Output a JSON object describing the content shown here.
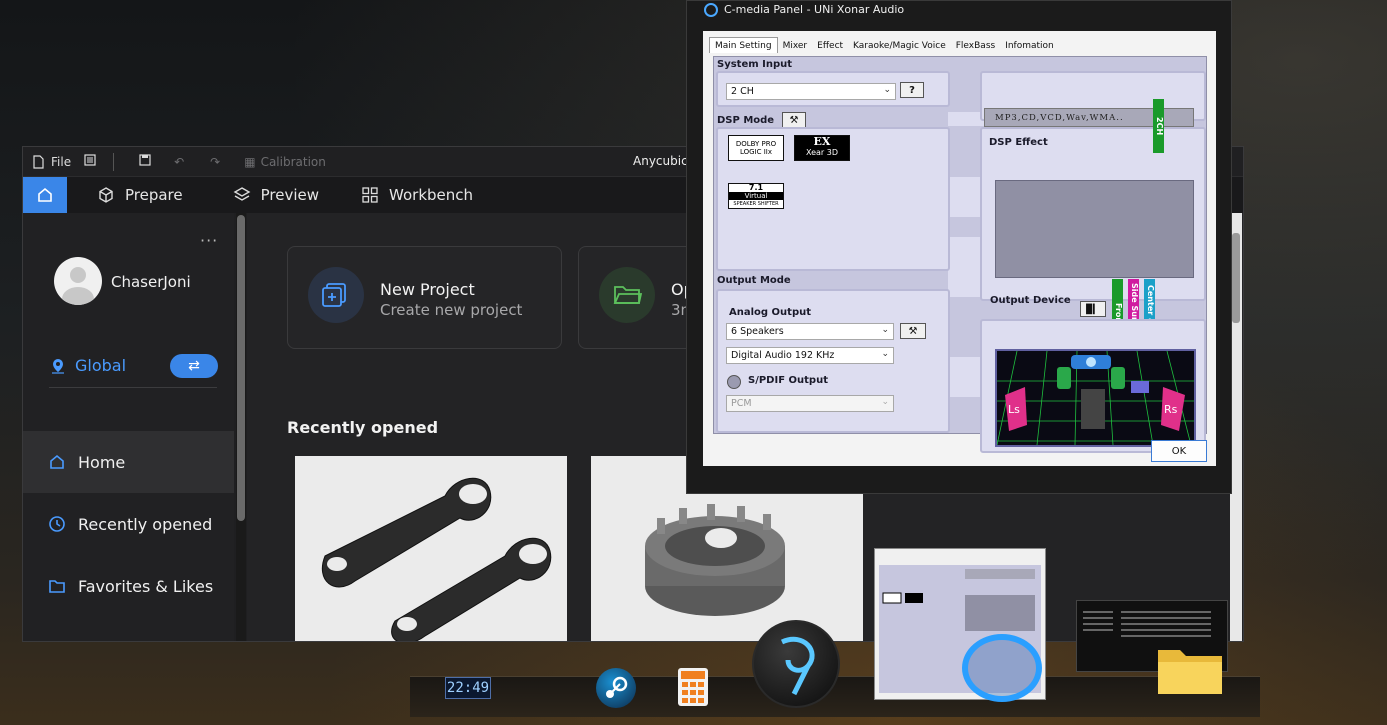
{
  "anycubic": {
    "title": "Anycubic S",
    "toolbar": {
      "file_label": "File",
      "calibration_label": "Calibration"
    },
    "nav": {
      "prepare": "Prepare",
      "preview": "Preview",
      "workbench": "Workbench"
    },
    "user": {
      "name": "ChaserJoni",
      "more": "···"
    },
    "region": {
      "label": "Global",
      "swap_symbol": "⇄"
    },
    "sidebar": [
      {
        "label": "Home",
        "icon": "home-icon"
      },
      {
        "label": "Recently opened",
        "icon": "clock-icon"
      },
      {
        "label": "Favorites & Likes",
        "icon": "folder-icon"
      }
    ],
    "cards": {
      "new_title": "New Project",
      "new_sub": "Create new project",
      "open_title": "Op",
      "open_sub": "3m"
    },
    "recent_heading": "Recently opened",
    "accent": "#3a86e8"
  },
  "cmedia": {
    "title": "C-media Panel - UNi Xonar Audio",
    "tabs": [
      "Main Setting",
      "Mixer",
      "Effect",
      "Karaoke/Magic Voice",
      "FlexBass",
      "Infomation"
    ],
    "system_input_label": "System Input",
    "system_input_value": "2 CH",
    "help_label": "?",
    "source_display": "MP3,CD,VCD,Wav,WMA..",
    "dsp_mode_label": "DSP Mode",
    "dolby_badge": "DOLBY PRO LOGIC IIx",
    "ex_badge_top": "EX",
    "ex_badge_bottom": "Xear 3D",
    "virtual_badge_top": "7.1",
    "virtual_badge_mid": "Virtual",
    "virtual_badge_bottom": "SPEAKER SHIFTER",
    "dsp_effect_label": "DSP Effect",
    "output_mode_label": "Output Mode",
    "analog_output_label": "Analog Output",
    "analog_output_value": "6 Speakers",
    "digital_audio_value": "Digital Audio 192 KHz",
    "spdif_label": "S/PDIF Output",
    "spdif_value": "PCM",
    "output_device_label": "Output Device",
    "bars": {
      "ch2": "2CH",
      "front": "Front",
      "side_surround": "Side Surround",
      "center_sub": "Center & Sub"
    },
    "speaker_labels": {
      "ls": "Ls",
      "rs": "Rs"
    },
    "ok_label": "OK"
  },
  "dock": {
    "clock": "22:49"
  }
}
